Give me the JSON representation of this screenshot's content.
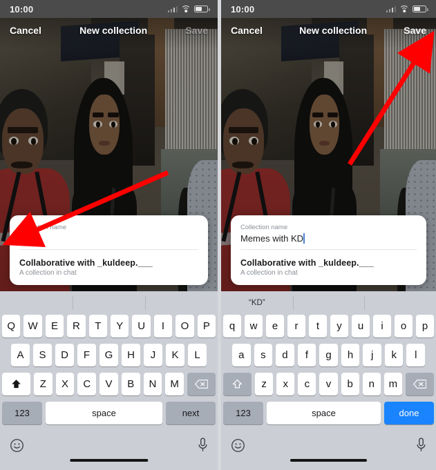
{
  "panels": [
    {
      "id": "before",
      "statusbar": {
        "time": "10:00",
        "signal_icon": "cellular-signal-icon",
        "wifi_icon": "wifi-icon",
        "battery_icon": "battery-icon"
      },
      "navbar": {
        "cancel_label": "Cancel",
        "title": "New collection",
        "save_label": "Save",
        "save_enabled": false
      },
      "card": {
        "field_label": "Collection name",
        "field_value": "",
        "show_caret": true,
        "sub_title": "Collaborative with _kuldeep.___",
        "sub_desc": "A collection in chat"
      },
      "keyboard": {
        "predictions": [
          "",
          "",
          ""
        ],
        "row1": [
          "Q",
          "W",
          "E",
          "R",
          "T",
          "Y",
          "U",
          "I",
          "O",
          "P"
        ],
        "row2": [
          "A",
          "S",
          "D",
          "F",
          "G",
          "H",
          "J",
          "K",
          "L"
        ],
        "row3": [
          "Z",
          "X",
          "C",
          "V",
          "B",
          "N",
          "M"
        ],
        "shift_icon": "shift-filled-icon",
        "shift_active": true,
        "backspace_icon": "backspace-icon",
        "numbers_label": "123",
        "space_label": "space",
        "action_label": "next",
        "action_is_blue": false,
        "emoji_icon": "emoji-smiley-icon",
        "mic_icon": "microphone-icon"
      },
      "annotation": {
        "arrow": "arrow-pointing-to-collection-name-field",
        "color": "#ff0000"
      }
    },
    {
      "id": "after",
      "statusbar": {
        "time": "10:00",
        "signal_icon": "cellular-signal-icon",
        "wifi_icon": "wifi-icon",
        "battery_icon": "battery-icon"
      },
      "navbar": {
        "cancel_label": "Cancel",
        "title": "New collection",
        "save_label": "Save",
        "save_enabled": true
      },
      "card": {
        "field_label": "Collection name",
        "field_value": "Memes with KD",
        "show_caret": true,
        "sub_title": "Collaborative with _kuldeep.___",
        "sub_desc": "A collection in chat"
      },
      "keyboard": {
        "predictions": [
          "“KD”",
          "",
          ""
        ],
        "row1": [
          "q",
          "w",
          "e",
          "r",
          "t",
          "y",
          "u",
          "i",
          "o",
          "p"
        ],
        "row2": [
          "a",
          "s",
          "d",
          "f",
          "g",
          "h",
          "j",
          "k",
          "l"
        ],
        "row3": [
          "z",
          "x",
          "c",
          "v",
          "b",
          "n",
          "m"
        ],
        "shift_icon": "shift-outline-icon",
        "shift_active": false,
        "backspace_icon": "backspace-icon",
        "numbers_label": "123",
        "space_label": "space",
        "action_label": "done",
        "action_is_blue": true,
        "emoji_icon": "emoji-smiley-icon",
        "mic_icon": "microphone-icon"
      },
      "annotation": {
        "arrow": "arrow-pointing-to-save-button",
        "color": "#ff0000"
      }
    }
  ],
  "theme": {
    "accent_blue": "#1a84ff",
    "caret_blue": "#4b7fd6",
    "keyboard_bg": "#cbced4",
    "key_bg": "#ffffff",
    "special_key_bg": "#a7adb7",
    "annotation_red": "#ff0000"
  }
}
